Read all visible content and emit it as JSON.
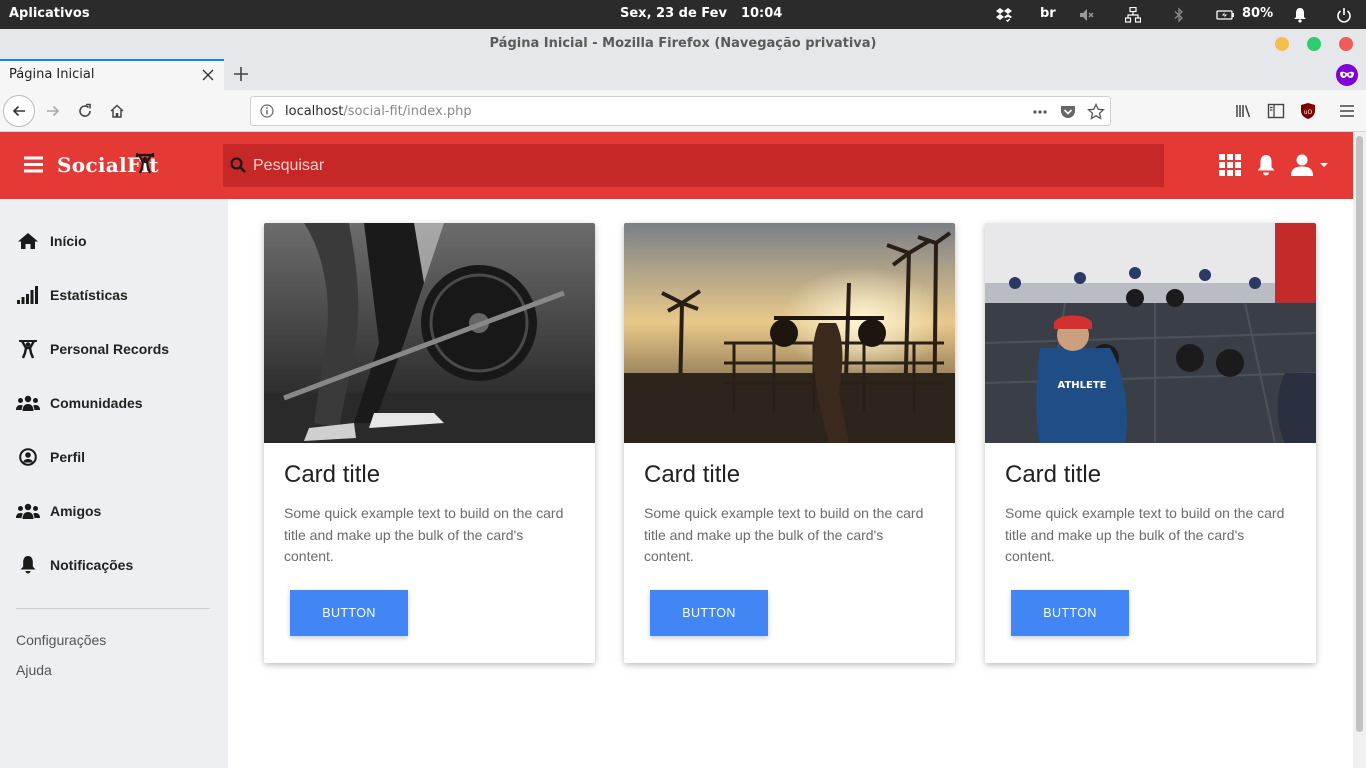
{
  "os_bar": {
    "apps_label": "Aplicativos",
    "date": "Sex, 23 de Fev",
    "time": "10:04",
    "keyboard_layout": "br",
    "battery": "80%",
    "icons": [
      "dropbox-icon",
      "volume-muted-icon",
      "network-icon",
      "bluetooth-icon",
      "battery-icon",
      "notification-bell-icon",
      "power-icon"
    ]
  },
  "browser": {
    "window_title": "Página Inicial - Mozilla Firefox (Navegação privativa)",
    "tab_title": "Página Inicial",
    "url_host": "localhost",
    "url_path": "/social-fit/index.php",
    "accent": "#0a84ff"
  },
  "app": {
    "brand": "SocialFit",
    "search_placeholder": "Pesquisar",
    "colors": {
      "header": "#e53935",
      "search": "#c62828",
      "button": "#4285f4",
      "sidebar": "#eeeff2"
    }
  },
  "sidebar": {
    "items": [
      {
        "label": "Início",
        "icon": "home-icon"
      },
      {
        "label": "Estatísticas",
        "icon": "signal-bars-icon"
      },
      {
        "label": "Personal Records",
        "icon": "weightlifter-icon"
      },
      {
        "label": "Comunidades",
        "icon": "users-icon"
      },
      {
        "label": "Perfil",
        "icon": "user-circle-icon"
      },
      {
        "label": "Amigos",
        "icon": "users-icon"
      },
      {
        "label": "Notificações",
        "icon": "bell-icon"
      }
    ],
    "links": [
      "Configurações",
      "Ajuda"
    ]
  },
  "cards": [
    {
      "title": "Card title",
      "text": "Some quick example text to build on the card title and make up the bulk of the card's content.",
      "button": "BUTTON"
    },
    {
      "title": "Card title",
      "text": "Some quick example text to build on the card title and make up the bulk of the card's content.",
      "button": "BUTTON"
    },
    {
      "title": "Card title",
      "text": "Some quick example text to build on the card title and make up the bulk of the card's content.",
      "button": "BUTTON"
    }
  ]
}
